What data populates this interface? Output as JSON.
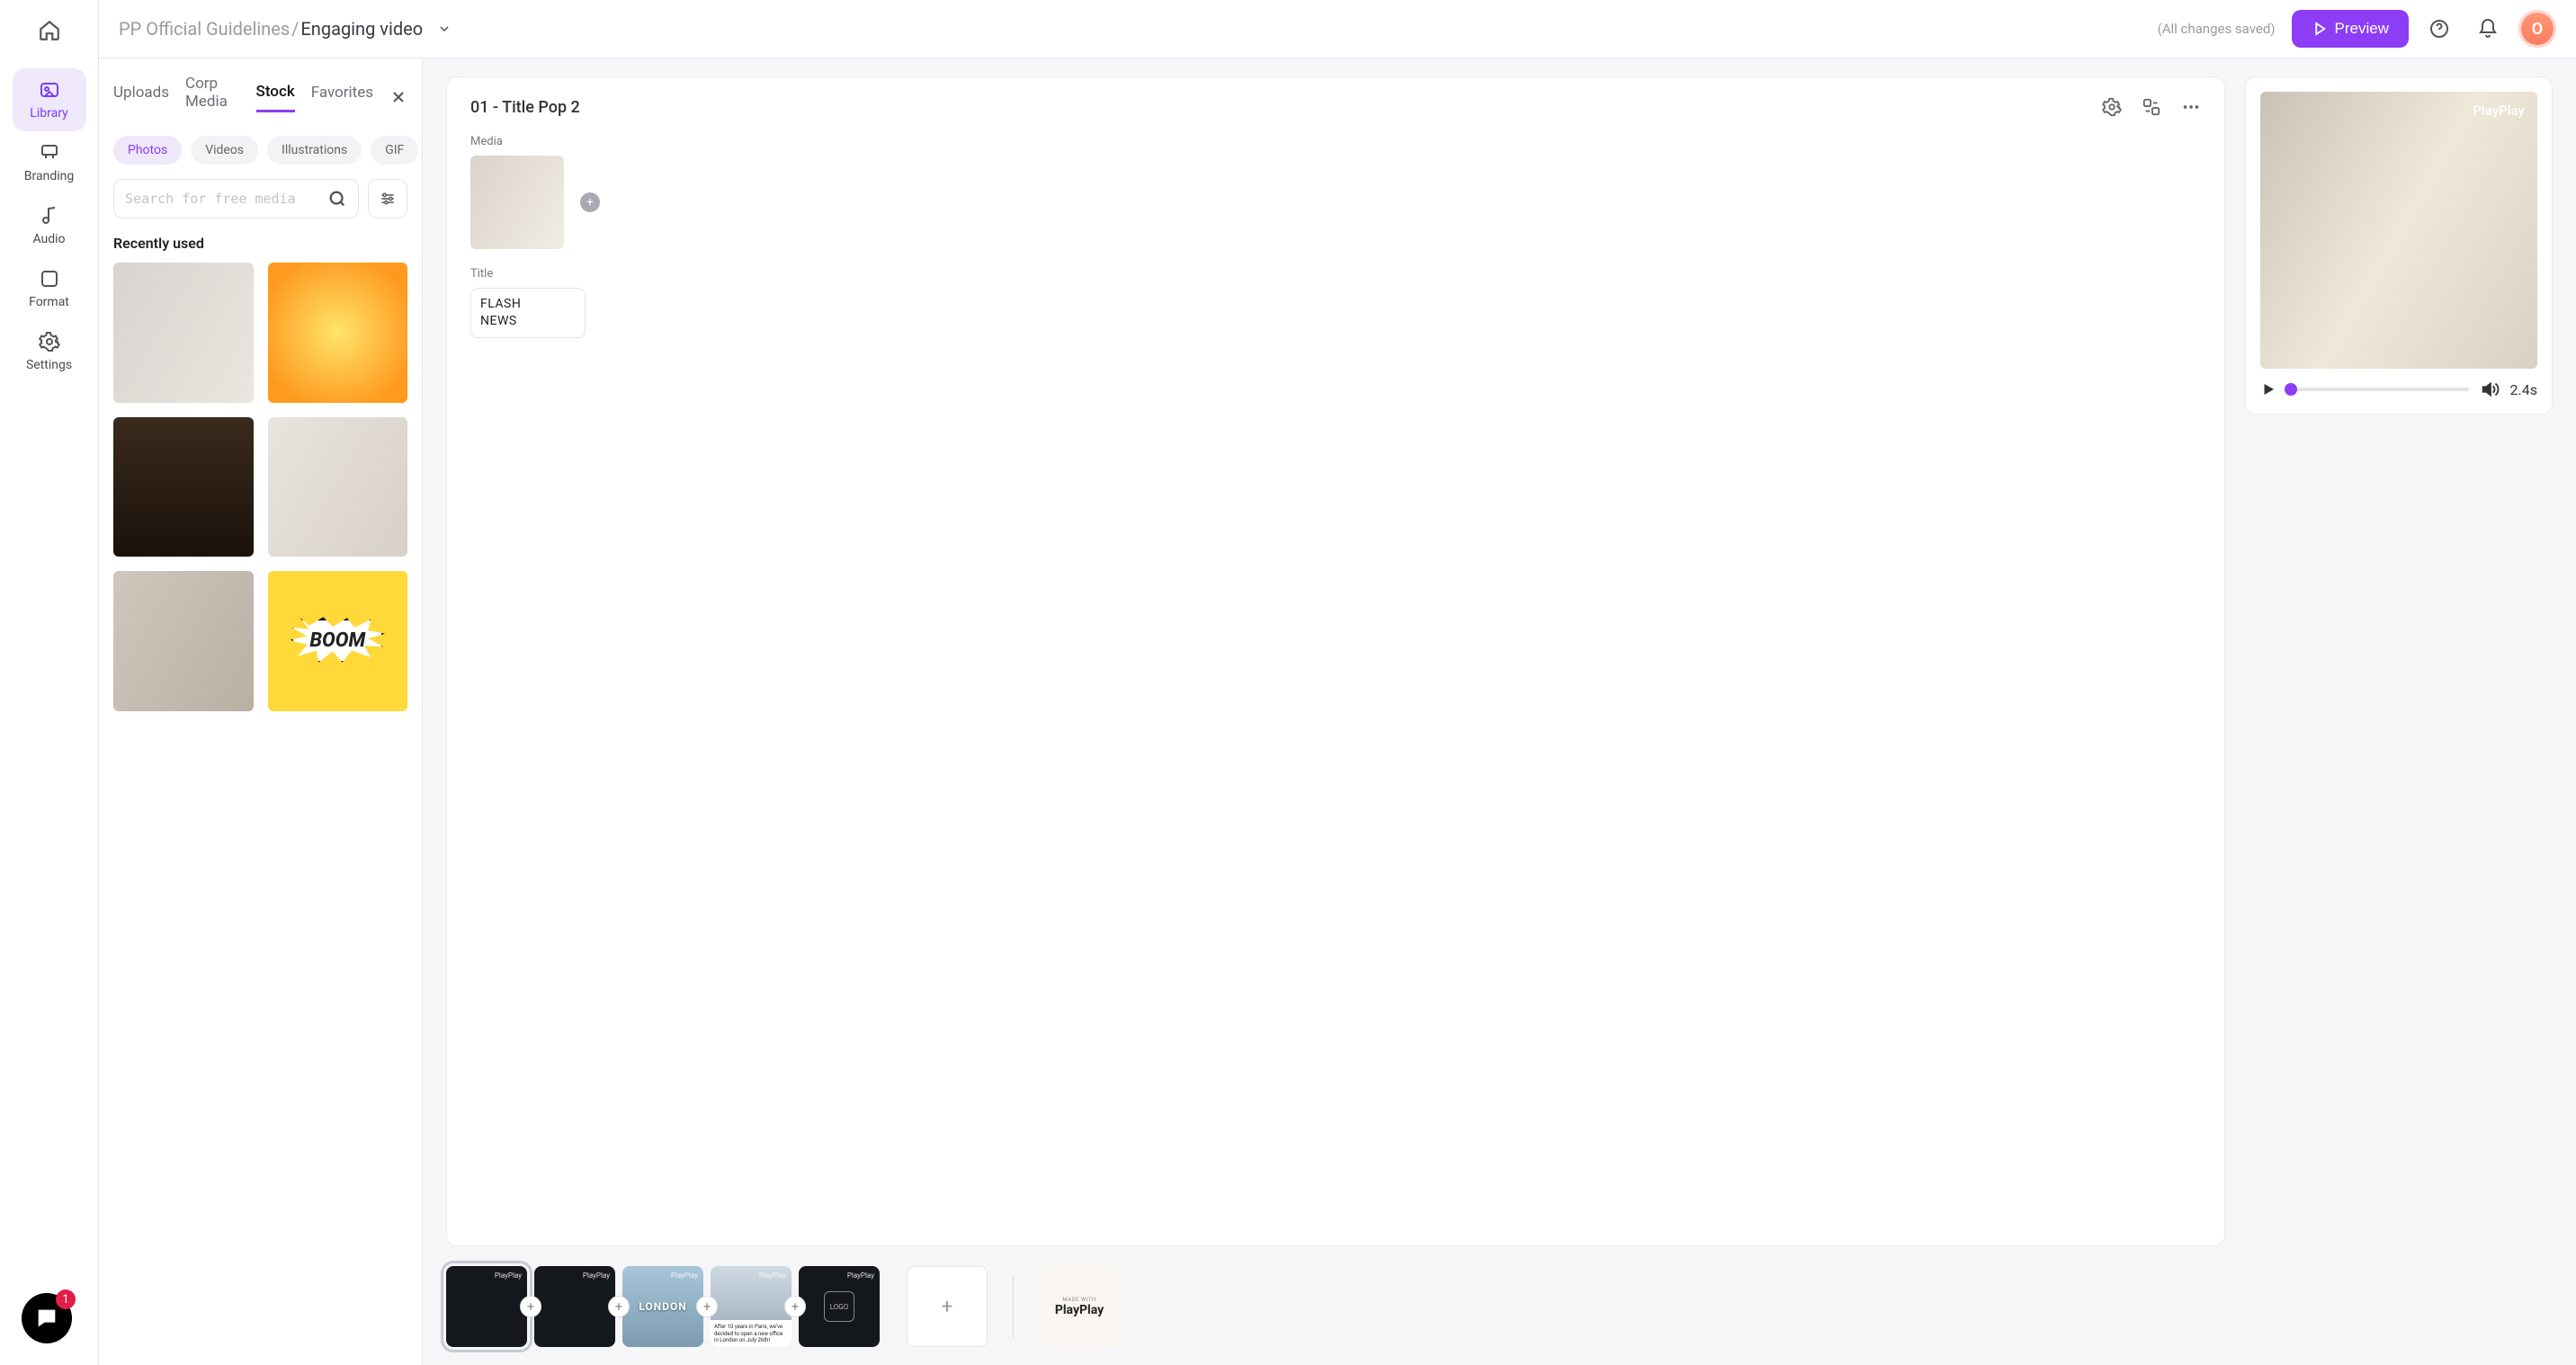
{
  "breadcrumb": {
    "parent": "PP Official Guidelines",
    "sep": " / ",
    "current": "Engaging video"
  },
  "topbar": {
    "saved": "(All changes saved)",
    "preview": "Preview",
    "avatar_initial": "O"
  },
  "rail": {
    "items": [
      {
        "label": "Library"
      },
      {
        "label": "Branding"
      },
      {
        "label": "Audio"
      },
      {
        "label": "Format"
      },
      {
        "label": "Settings"
      }
    ],
    "chat_badge": "1"
  },
  "library": {
    "tabs": [
      "Uploads",
      "Corp Media",
      "Stock",
      "Favorites"
    ],
    "active_tab": "Stock",
    "chips": [
      "Photos",
      "Videos",
      "Illustrations",
      "GIF"
    ],
    "active_chip": "Photos",
    "search_placeholder": "Search for free media",
    "section": "Recently used",
    "thumbs": [
      "office1",
      "sunburst",
      "auditorium",
      "postits",
      "happy",
      "boom"
    ],
    "boom_text": "BOOM"
  },
  "form": {
    "heading": "01 - Title Pop 2",
    "media_label": "Media",
    "title_label": "Title",
    "title_value": "FLASH\nNEWS"
  },
  "preview": {
    "watermark": "PlayPlay",
    "duration": "2.4s"
  },
  "timeline": {
    "london": "LONDON",
    "paris_caption": "After 10 years in Paris, we've decided to open a new office in London on July 26th!",
    "logo": "LOGO",
    "made": "MADE WITH",
    "brand": "PlayPlay"
  }
}
